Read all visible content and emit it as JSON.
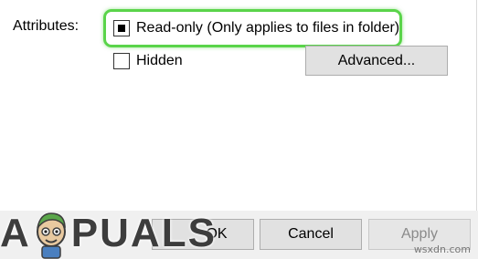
{
  "attributes": {
    "label": "Attributes:",
    "readonly_label": "Read-only (Only applies to files in folder)",
    "readonly_state": "indeterminate",
    "hidden_label": "Hidden",
    "hidden_state": "unchecked",
    "advanced_label": "Advanced..."
  },
  "footer": {
    "ok_label": "OK",
    "cancel_label": "Cancel",
    "apply_label": "Apply"
  },
  "logo": {
    "letters": [
      "A",
      "P",
      "U",
      "A",
      "L",
      "S"
    ]
  },
  "watermark": "wsxdn.com",
  "colors": {
    "highlight": "#5ad44a",
    "button_bg": "#e1e1e1",
    "footer_bg": "#f0f0f0"
  }
}
